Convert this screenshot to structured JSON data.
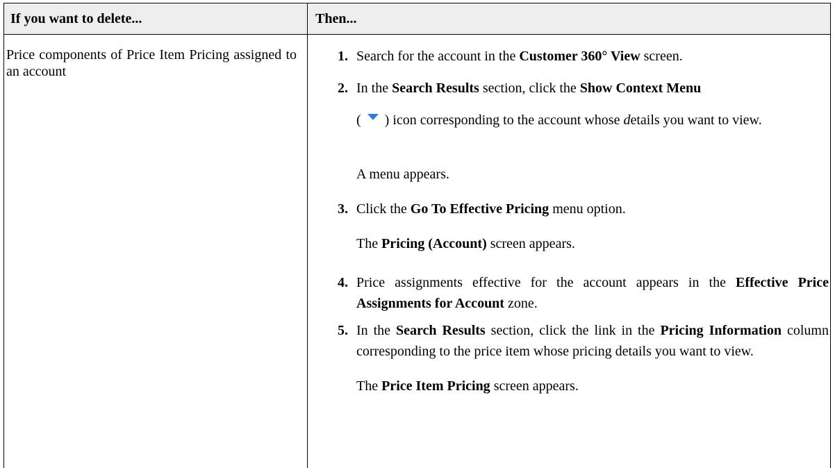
{
  "table": {
    "header_left": "If you want to delete...",
    "header_right": "Then...",
    "left_cell": "Price components of Price Item Pricing assigned to an account"
  },
  "steps": [
    {
      "num": "1.",
      "parts": [
        [
          "t",
          "Search for the account in the "
        ],
        [
          "b",
          "Customer 360° View"
        ],
        [
          "t",
          " screen."
        ]
      ]
    },
    {
      "num": "2.",
      "parts": [
        [
          "t",
          "In the "
        ],
        [
          "b",
          "Search Results"
        ],
        [
          "t",
          " section, click the "
        ],
        [
          "b",
          "Show Context Menu"
        ]
      ]
    },
    {
      "num": "",
      "parts": [
        [
          "t",
          "( "
        ],
        [
          "icon",
          "chevron-down-icon"
        ],
        [
          "t",
          " ) icon corresponding to the account whose "
        ],
        [
          "i",
          "d"
        ],
        [
          "t",
          "etails you want to view."
        ]
      ]
    },
    {
      "num": "",
      "parts": [
        [
          "t",
          "A menu appears."
        ]
      ]
    },
    {
      "num": "3.",
      "parts": [
        [
          "t",
          "Click the "
        ],
        [
          "b",
          "Go To Effective Pricing"
        ],
        [
          "t",
          " menu option."
        ]
      ]
    },
    {
      "num": "",
      "parts": [
        [
          "t",
          "The "
        ],
        [
          "b",
          "Pricing (Account)"
        ],
        [
          "t",
          " screen appears."
        ]
      ]
    },
    {
      "num": "4.",
      "parts": [
        [
          "t",
          "Price assignments effective for the account appears in the "
        ],
        [
          "b",
          "Effective Price Assignments for Account"
        ],
        [
          "t",
          " zone."
        ]
      ]
    },
    {
      "num": "5.",
      "parts": [
        [
          "t",
          "In the "
        ],
        [
          "b",
          "Search Results"
        ],
        [
          "t",
          " section, click the link in the "
        ],
        [
          "b",
          "Pricing Information"
        ],
        [
          "t",
          " column corresponding to the price item whose pricing details you want to view."
        ]
      ]
    },
    {
      "num": "",
      "parts": [
        [
          "t",
          "The "
        ],
        [
          "b",
          "Price Item Pricing"
        ],
        [
          "t",
          " screen appears."
        ]
      ]
    }
  ],
  "colors": {
    "icon": "#2a7de1",
    "header_bg": "#eeeeee"
  }
}
